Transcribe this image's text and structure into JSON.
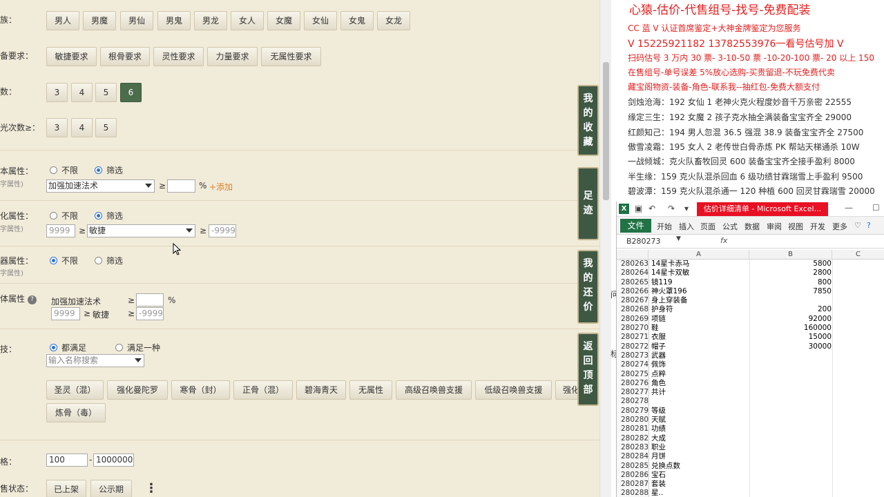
{
  "filters": {
    "race": {
      "label": "族：",
      "options": [
        "男人",
        "男魔",
        "男仙",
        "男鬼",
        "男龙",
        "女人",
        "女魔",
        "女仙",
        "女鬼",
        "女龙"
      ]
    },
    "equip_req": {
      "label": "备要求：",
      "options": [
        "敏捷要求",
        "根骨要求",
        "灵性要求",
        "力量要求",
        "无属性要求"
      ]
    },
    "count": {
      "label": "数：",
      "options": [
        "3",
        "4",
        "5",
        "6"
      ],
      "selected": "6"
    },
    "light_count": {
      "label": "光次数≥：",
      "options": [
        "3",
        "4",
        "5"
      ]
    },
    "base_attr": {
      "label": "本属性：",
      "sub": "字属性)",
      "radio_none": "不限",
      "radio_filter": "筛选",
      "select_value": "加强加速法术",
      "ge": "≥",
      "percent": "%",
      "add_link": "+添加"
    },
    "refine_attr": {
      "label": "化属性：",
      "sub": "字属性)",
      "radio_none": "不限",
      "radio_filter": "筛选",
      "input_left": "9999",
      "ge": "≥",
      "select_value": "敏捷",
      "input_right": "-9999"
    },
    "weapon_attr": {
      "label": "器属性：",
      "sub": "字属性)",
      "radio_none": "不限",
      "radio_filter": "筛选"
    },
    "body_attr": {
      "label": "体属性",
      "line1_label": "加强加速法术",
      "ge": "≥",
      "percent": "%",
      "input_left": "9999",
      "line2_label": "敏捷",
      "input_right": "-9999"
    },
    "skills": {
      "label": "技：",
      "radio_all": "都满足",
      "radio_one": "满足一种",
      "search_placeholder": "输入名称搜索",
      "options": [
        "圣灵（混）",
        "强化曼陀罗",
        "寒骨（封）",
        "正骨（混）",
        "碧海青天",
        "无属性",
        "高级召唤兽支援",
        "低级召唤兽支援",
        "强化"
      ],
      "options_row2": [
        "炼骨（毒）"
      ]
    },
    "price": {
      "label": "格：",
      "min": "100",
      "dash": "-",
      "max": "1000000"
    },
    "sale_status": {
      "label": "售状态：",
      "options": [
        "已上架",
        "公示期"
      ],
      "more": "⋮"
    }
  },
  "side_tabs": [
    {
      "label": [
        "我",
        "的",
        "收",
        "藏"
      ]
    },
    {
      "label": [
        "足",
        "迹"
      ]
    },
    {
      "label": [
        "我",
        "的",
        "还",
        "价"
      ]
    },
    {
      "label": [
        "返",
        "回",
        "顶",
        "部"
      ]
    }
  ],
  "post": {
    "title": "心猿-估价-代售组号-找号-免费配装",
    "lines": [
      "CC 蓝 V 认证首席鉴定+大神金牌鉴定为您服务",
      "V 15225921182      13782553976一看号估号加 V",
      "扫码估号 3 万内 30 票- 3-10-50 票  -10-20-100 票- 20 以上 150",
      "在售组号-单号误差 5%放心选购-买贵留退-不玩免费代卖",
      "藏宝阁物资-装备-角色-联系我--抽红包-免费大额支付",
      "剑烛沧海：192 女仙 1 老神火克火程度妙音千万亲密 22555",
      "缘定三生：192 女魔 2 孩子克水抽全满装备宝宝齐全 29000",
      "红颜知己：194 男人忽混 36.5 强混 38.9 装备宝宝齐全 27500",
      "傲雪凌霜：195 女人 2 老传世白骨赤炼 PK 帮站天梯通杀 10W",
      "一战倾城：克火队畜牧回灵 600 装备宝宝齐全接手盈利 8000",
      "半生缘：159 克火队混杀回血 6 级功绩甘霖瑞雪上手盈利 9500",
      "碧波潭：159 克火队混杀通一 120 种植 600 回灵甘霖瑞雪 20000"
    ]
  },
  "excel": {
    "app_icon": "X",
    "window_title": "估价详细清单 - Microsoft Excel...",
    "tabs": [
      "文件",
      "开始",
      "插入",
      "页面",
      "公式",
      "数据",
      "审阅",
      "视图",
      "开发",
      "更多"
    ],
    "name_box": "B280273",
    "fx": "fx",
    "columns": [
      "A",
      "B",
      "C"
    ],
    "rows": [
      {
        "n": "280263",
        "a": "14星卡赤马",
        "b": "5800"
      },
      {
        "n": "280264",
        "a": "14星卡双敏",
        "b": "2800"
      },
      {
        "n": "280265",
        "a": "镜119",
        "b": "800"
      },
      {
        "n": "280266",
        "a": "神火罩196",
        "b": "7850"
      },
      {
        "n": "280267",
        "a": "身上穿装备",
        "b": ""
      },
      {
        "n": "280268",
        "a": "护身符",
        "b": "200"
      },
      {
        "n": "280269",
        "a": "项链",
        "b": "92000"
      },
      {
        "n": "280270",
        "a": "鞋",
        "b": "160000"
      },
      {
        "n": "280271",
        "a": "衣服",
        "b": "15000"
      },
      {
        "n": "280272",
        "a": "帽子",
        "b": "30000"
      },
      {
        "n": "280273",
        "a": "武器",
        "b": ""
      },
      {
        "n": "280274",
        "a": "佩饰",
        "b": ""
      },
      {
        "n": "280275",
        "a": "点粹",
        "b": ""
      },
      {
        "n": "280276",
        "a": "角色",
        "b": ""
      },
      {
        "n": "280277",
        "a": "共计",
        "b": ""
      },
      {
        "n": "280278",
        "a": "",
        "b": ""
      },
      {
        "n": "280279",
        "a": "等级",
        "b": ""
      },
      {
        "n": "280280",
        "a": "天赋",
        "b": ""
      },
      {
        "n": "280281",
        "a": "功绩",
        "b": ""
      },
      {
        "n": "280282",
        "a": "大成",
        "b": ""
      },
      {
        "n": "280283",
        "a": "职业",
        "b": ""
      },
      {
        "n": "280284",
        "a": "月饼",
        "b": ""
      },
      {
        "n": "280285",
        "a": "兑换点数",
        "b": ""
      },
      {
        "n": "280286",
        "a": "宝石",
        "b": ""
      },
      {
        "n": "280287",
        "a": "套装",
        "b": ""
      },
      {
        "n": "280288",
        "a": "星..",
        "b": ""
      }
    ]
  },
  "mid_fragments": [
    "问",
    "标"
  ]
}
